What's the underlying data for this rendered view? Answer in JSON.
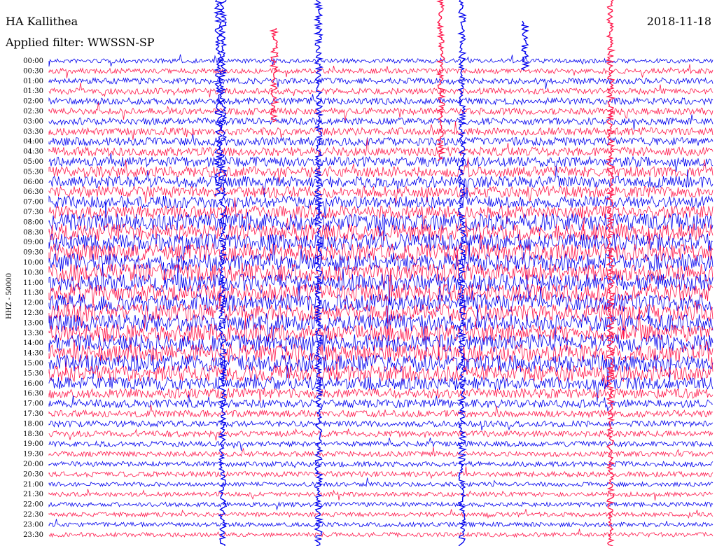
{
  "header": {
    "station": "HA Kallithea",
    "filter": "Applied filter: WWSSN-SP",
    "date": "2018-11-18"
  },
  "channel_label": "HHZ - 50000",
  "chart_data": {
    "type": "line",
    "time_labels": [
      "00:00",
      "00:30",
      "01:00",
      "01:30",
      "02:00",
      "02:30",
      "03:00",
      "03:30",
      "04:00",
      "04:30",
      "05:00",
      "05:30",
      "06:00",
      "06:30",
      "07:00",
      "07:30",
      "08:00",
      "08:30",
      "09:00",
      "09:30",
      "10:00",
      "10:30",
      "11:00",
      "11:30",
      "12:00",
      "12:30",
      "13:00",
      "13:30",
      "14:00",
      "14:30",
      "15:00",
      "15:30",
      "16:00",
      "16:30",
      "17:00",
      "17:30",
      "18:00",
      "18:30",
      "19:00",
      "19:30",
      "20:00",
      "20:30",
      "21:00",
      "21:30",
      "22:00",
      "22:30",
      "23:00",
      "23:30"
    ],
    "trace_colors": [
      "#0000ee",
      "#ff1a4d"
    ],
    "noise_level": [
      0.15,
      0.2,
      0.25,
      0.25,
      0.3,
      0.3,
      0.3,
      0.35,
      0.4,
      0.45,
      0.5,
      0.55,
      0.6,
      0.6,
      0.65,
      0.7,
      1.0,
      1.0,
      1.0,
      1.0,
      1.0,
      1.0,
      1.0,
      1.0,
      1.0,
      1.0,
      1.0,
      1.0,
      1.0,
      1.0,
      1.0,
      0.9,
      0.7,
      0.5,
      0.4,
      0.3,
      0.25,
      0.25,
      0.2,
      0.2,
      0.2,
      0.2,
      0.15,
      0.15,
      0.15,
      0.15,
      0.15,
      0.15
    ]
  }
}
